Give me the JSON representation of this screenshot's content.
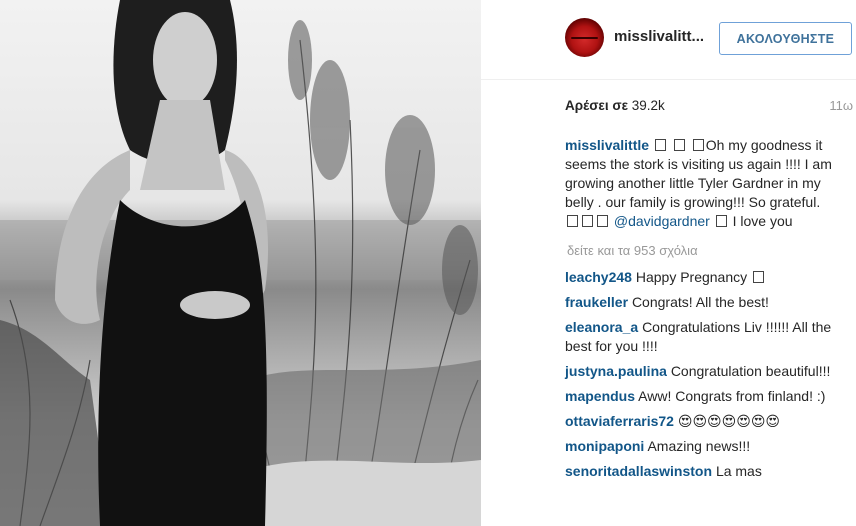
{
  "post": {
    "username": "misslivalitt...",
    "follow_label": "ΑΚΟΛΟΥΘΗΣΤΕ",
    "likes_label": "Αρέσει σε",
    "likes_count": "39.2k",
    "time_ago": "11ω"
  },
  "caption": {
    "user": "misslivalittle",
    "text_part1": "Oh my goodness it seems the stork is visiting us again !!!! I am growing another little Tyler Gardner in my belly . our family is growing!!! So grateful.",
    "mention": "@davidgardner",
    "text_part2": "I love you"
  },
  "view_all_label": "δείτε και τα 953 σχόλια",
  "comments": [
    {
      "user": "leachy248",
      "text": "Happy Pregnancy"
    },
    {
      "user": "fraukeller",
      "text": "Congrats! All the best!"
    },
    {
      "user": "eleanora_a",
      "text": "Congratulations Liv !!!!!! All the best for you !!!!"
    },
    {
      "user": "justyna.paulina",
      "text": "Congratulation beautiful!!!"
    },
    {
      "user": "mapendus",
      "text": "Aww! Congrats from finland! :)"
    },
    {
      "user": "ottaviaferraris72",
      "text": "😍😍😍😍😍😍😍"
    },
    {
      "user": "monipaponi",
      "text": "Amazing news!!!"
    },
    {
      "user": "senoritadallaswinston",
      "text": "La mas"
    }
  ],
  "icons": {
    "emoji_placeholder": "unrenderable-emoji-icon",
    "avatar": "red-lips-avatar-icon"
  }
}
